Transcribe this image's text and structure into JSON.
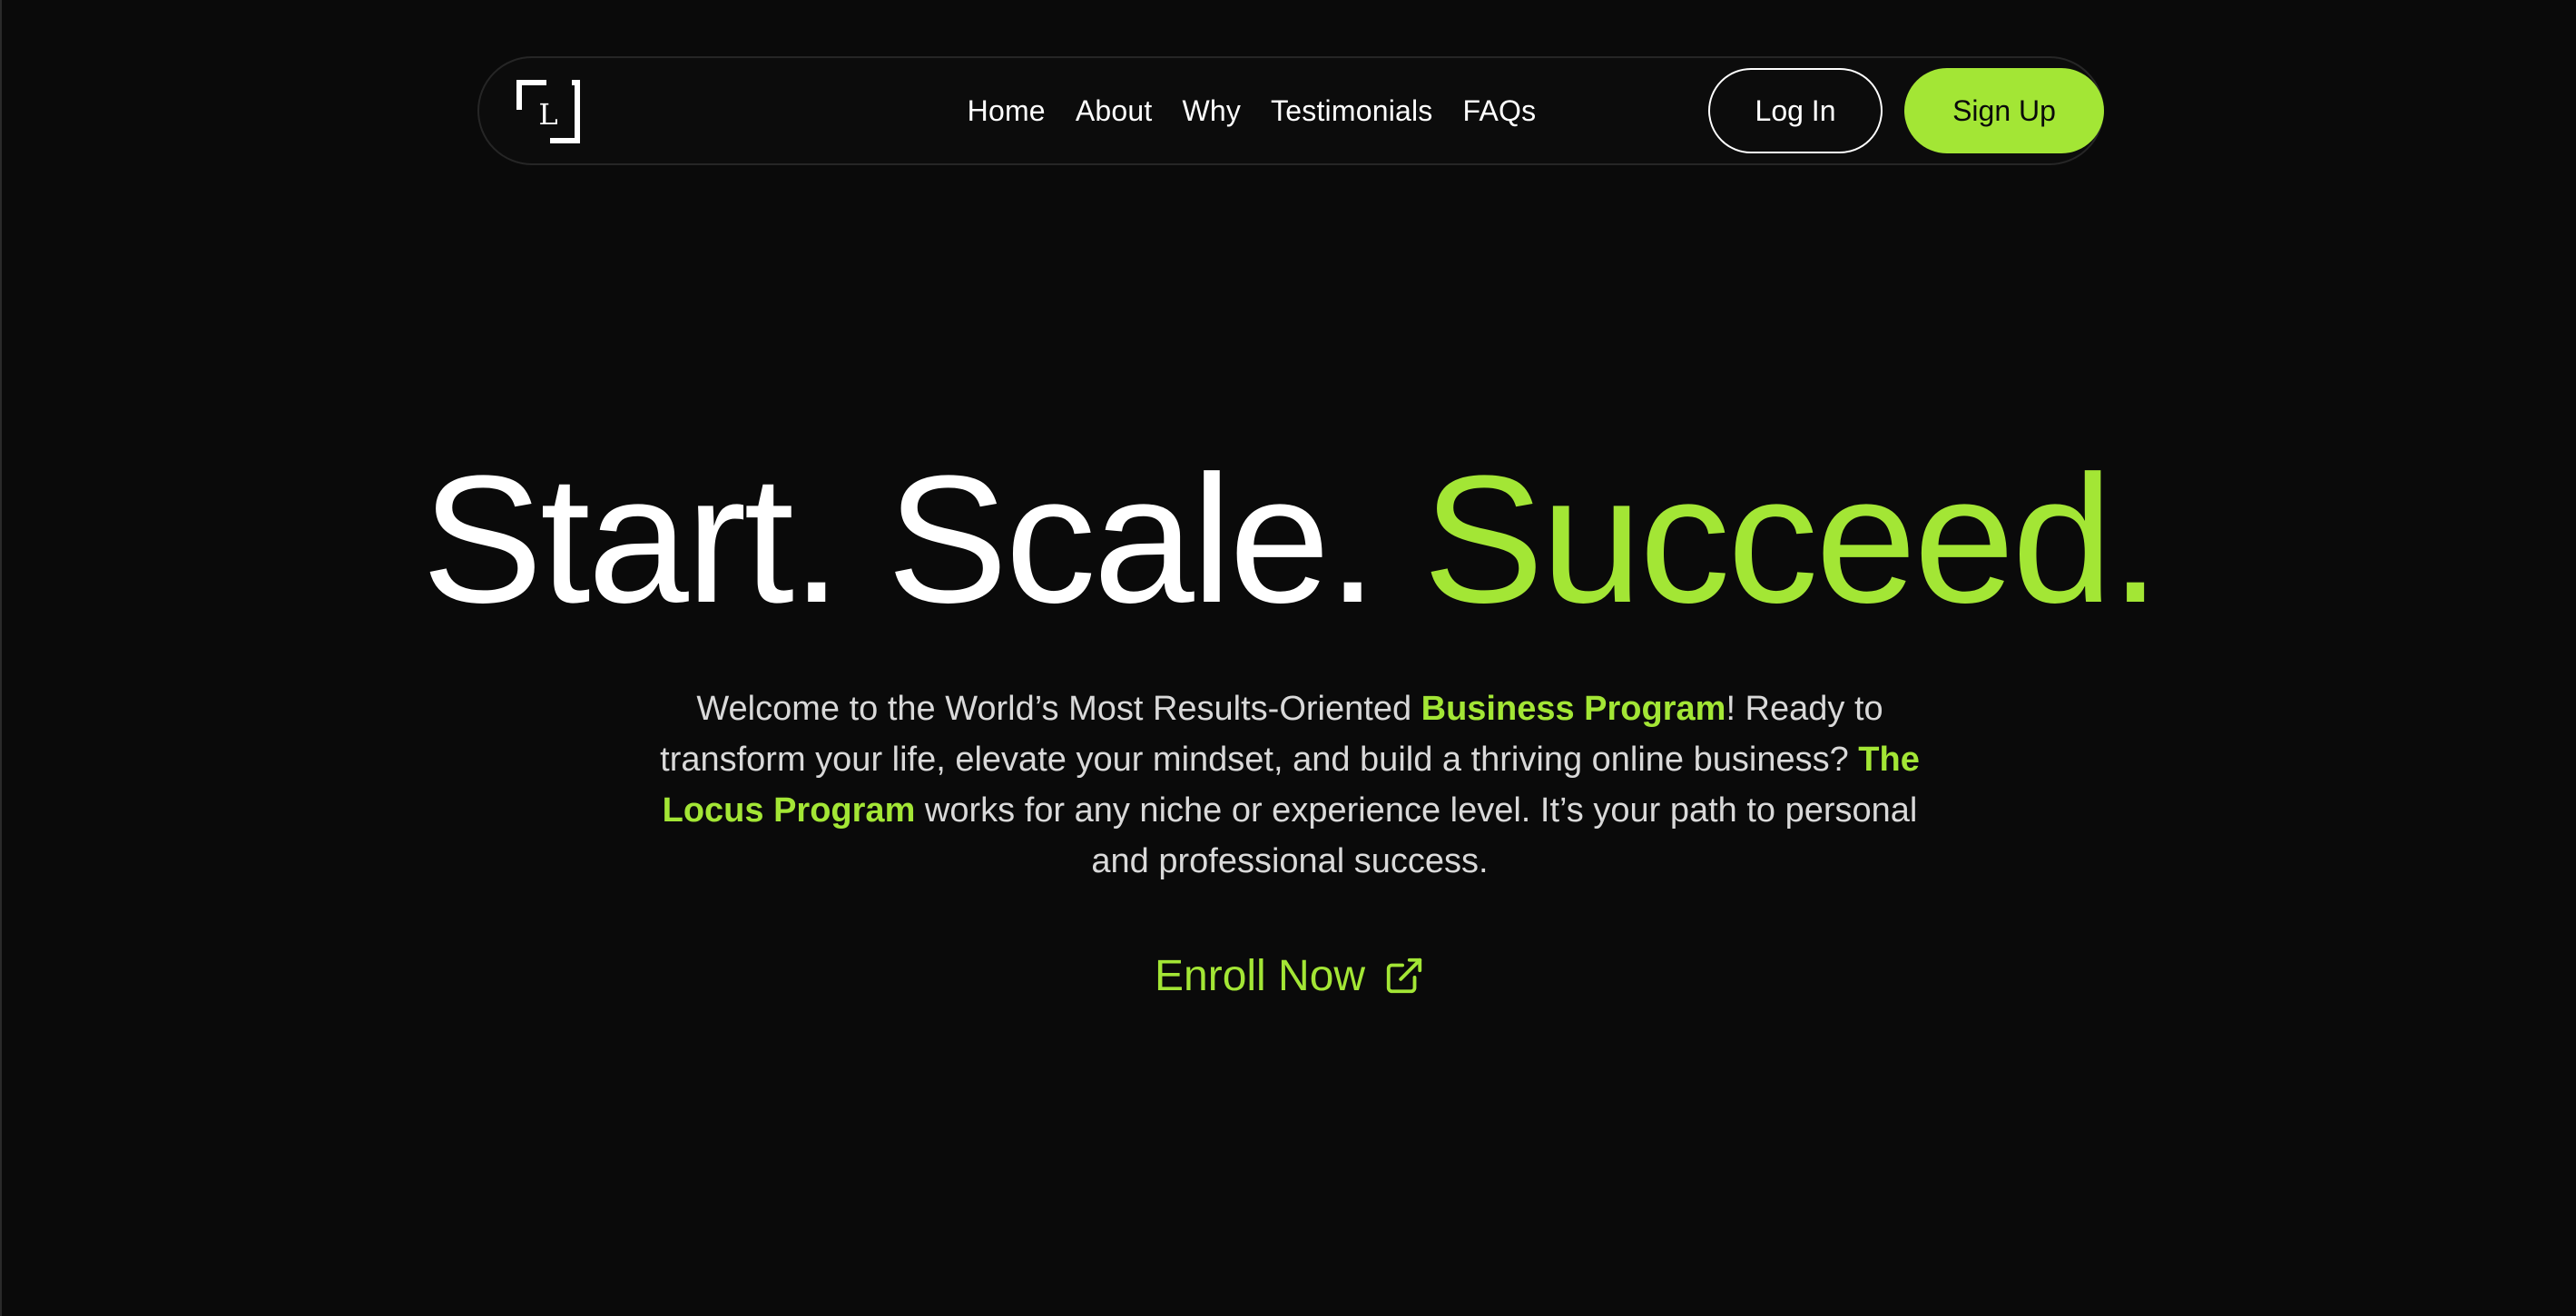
{
  "nav": {
    "logo_letter": "L",
    "links": [
      {
        "label": "Home"
      },
      {
        "label": "About"
      },
      {
        "label": "Why"
      },
      {
        "label": "Testimonials"
      },
      {
        "label": "FAQs"
      }
    ],
    "login_label": "Log In",
    "signup_label": "Sign Up"
  },
  "hero": {
    "title_part1": "Start. Scale.",
    "title_part2": "Succeed.",
    "desc_1": "Welcome to the World’s Most Results-Oriented ",
    "desc_hl_1": "Business Program",
    "desc_2": "! Ready to transform your life, elevate your mindset, and build a thriving online business? ",
    "desc_hl_2": "The Locus Program",
    "desc_3": " works for any niche or experience level. It’s your path to personal and professional success.",
    "cta_label": "Enroll Now",
    "cta_icon": "external-link-icon"
  },
  "colors": {
    "background": "#0a0a0a",
    "accent": "#a3e635",
    "text": "#ffffff",
    "muted_text": "#d9d9d9"
  }
}
